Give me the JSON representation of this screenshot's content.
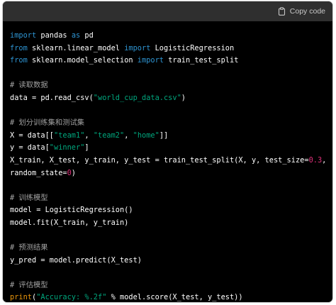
{
  "toolbar": {
    "copy_label": "Copy code",
    "copy_icon": "clipboard-icon"
  },
  "code": {
    "language": "python",
    "lines": [
      {
        "tokens": [
          {
            "t": "import",
            "c": "kw"
          },
          {
            "t": " pandas ",
            "c": ""
          },
          {
            "t": "as",
            "c": "kw"
          },
          {
            "t": " pd",
            "c": ""
          }
        ]
      },
      {
        "tokens": [
          {
            "t": "from",
            "c": "kw"
          },
          {
            "t": " sklearn.linear_model ",
            "c": ""
          },
          {
            "t": "import",
            "c": "kw"
          },
          {
            "t": " LogisticRegression",
            "c": ""
          }
        ]
      },
      {
        "tokens": [
          {
            "t": "from",
            "c": "kw"
          },
          {
            "t": " sklearn.model_selection ",
            "c": ""
          },
          {
            "t": "import",
            "c": "kw"
          },
          {
            "t": " train_test_split",
            "c": ""
          }
        ]
      },
      {
        "tokens": []
      },
      {
        "tokens": [
          {
            "t": "# 读取数据",
            "c": "cmt"
          }
        ]
      },
      {
        "tokens": [
          {
            "t": "data = pd.read_csv(",
            "c": ""
          },
          {
            "t": "\"world_cup_data.csv\"",
            "c": "str"
          },
          {
            "t": ")",
            "c": ""
          }
        ]
      },
      {
        "tokens": []
      },
      {
        "tokens": [
          {
            "t": "# 划分训练集和测试集",
            "c": "cmt"
          }
        ]
      },
      {
        "tokens": [
          {
            "t": "X = data[[",
            "c": ""
          },
          {
            "t": "\"team1\"",
            "c": "str"
          },
          {
            "t": ", ",
            "c": ""
          },
          {
            "t": "\"team2\"",
            "c": "str"
          },
          {
            "t": ", ",
            "c": ""
          },
          {
            "t": "\"home\"",
            "c": "str"
          },
          {
            "t": "]]",
            "c": ""
          }
        ]
      },
      {
        "tokens": [
          {
            "t": "y = data[",
            "c": ""
          },
          {
            "t": "\"winner\"",
            "c": "str"
          },
          {
            "t": "]",
            "c": ""
          }
        ]
      },
      {
        "tokens": [
          {
            "t": "X_train, X_test, y_train, y_test = train_test_split(X, y, test_size=",
            "c": ""
          },
          {
            "t": "0.3",
            "c": "num"
          },
          {
            "t": ",",
            "c": ""
          }
        ]
      },
      {
        "tokens": [
          {
            "t": "random_state=",
            "c": ""
          },
          {
            "t": "0",
            "c": "num"
          },
          {
            "t": ")",
            "c": ""
          }
        ]
      },
      {
        "tokens": []
      },
      {
        "tokens": [
          {
            "t": "# 训练模型",
            "c": "cmt"
          }
        ]
      },
      {
        "tokens": [
          {
            "t": "model = LogisticRegression()",
            "c": ""
          }
        ]
      },
      {
        "tokens": [
          {
            "t": "model.fit(X_train, y_train)",
            "c": ""
          }
        ]
      },
      {
        "tokens": []
      },
      {
        "tokens": [
          {
            "t": "# 预测结果",
            "c": "cmt"
          }
        ]
      },
      {
        "tokens": [
          {
            "t": "y_pred = model.predict(X_test)",
            "c": ""
          }
        ]
      },
      {
        "tokens": []
      },
      {
        "tokens": [
          {
            "t": "# 评估模型",
            "c": "cmt"
          }
        ]
      },
      {
        "tokens": [
          {
            "t": "print",
            "c": "fn"
          },
          {
            "t": "(",
            "c": ""
          },
          {
            "t": "\"Accuracy: %.2f\"",
            "c": "str"
          },
          {
            "t": " % model.score(X_test, y_test))",
            "c": ""
          }
        ]
      }
    ]
  },
  "colors": {
    "background": "#000000",
    "header": "#2f2f2f",
    "keyword": "#2e95d3",
    "string": "#00a67d",
    "number": "#df3079",
    "comment": "#a0a0a0",
    "builtin": "#e9950c"
  }
}
